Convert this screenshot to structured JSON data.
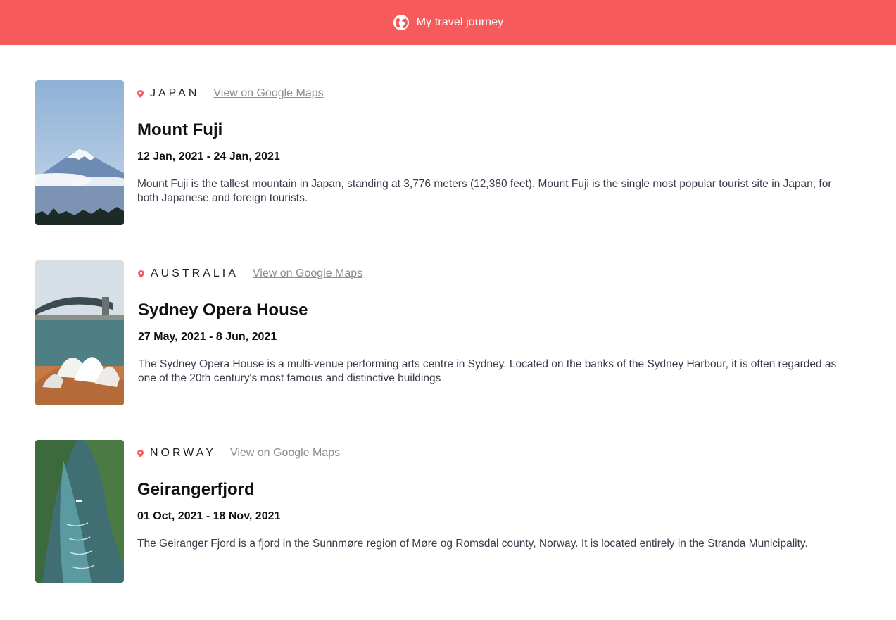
{
  "header": {
    "icon": "globe-icon",
    "title": "My travel journey",
    "background": "#f65a5b"
  },
  "entries": [
    {
      "image_icon": "mount-fuji-photo",
      "country": "JAPAN",
      "map_link": "View on Google Maps",
      "title": "Mount Fuji",
      "dates": "12 Jan, 2021 - 24 Jan, 2021",
      "description": "Mount Fuji is the tallest mountain in Japan, standing at 3,776 meters (12,380 feet). Mount Fuji is the single most popular tourist site in Japan, for both Japanese and foreign tourists."
    },
    {
      "image_icon": "sydney-opera-house-photo",
      "country": "AUSTRALIA",
      "map_link": "View on Google Maps",
      "title": "Sydney Opera House",
      "dates": "27 May, 2021 - 8 Jun, 2021",
      "description": "The Sydney Opera House is a multi-venue performing arts centre in Sydney. Located on the banks of the Sydney Harbour, it is often regarded as one of the 20th century's most famous and distinctive buildings"
    },
    {
      "image_icon": "geirangerfjord-photo",
      "country": "NORWAY",
      "map_link": "View on Google Maps",
      "title": "Geirangerfjord",
      "dates": "01 Oct, 2021 - 18 Nov, 2021",
      "description": "The Geiranger Fjord is a fjord in the Sunnmøre region of Møre og Romsdal county, Norway. It is located entirely in the Stranda Municipality."
    }
  ],
  "colors": {
    "accent": "#f65a5b",
    "link": "#8d8d8d",
    "pin": "#f65a5b"
  }
}
